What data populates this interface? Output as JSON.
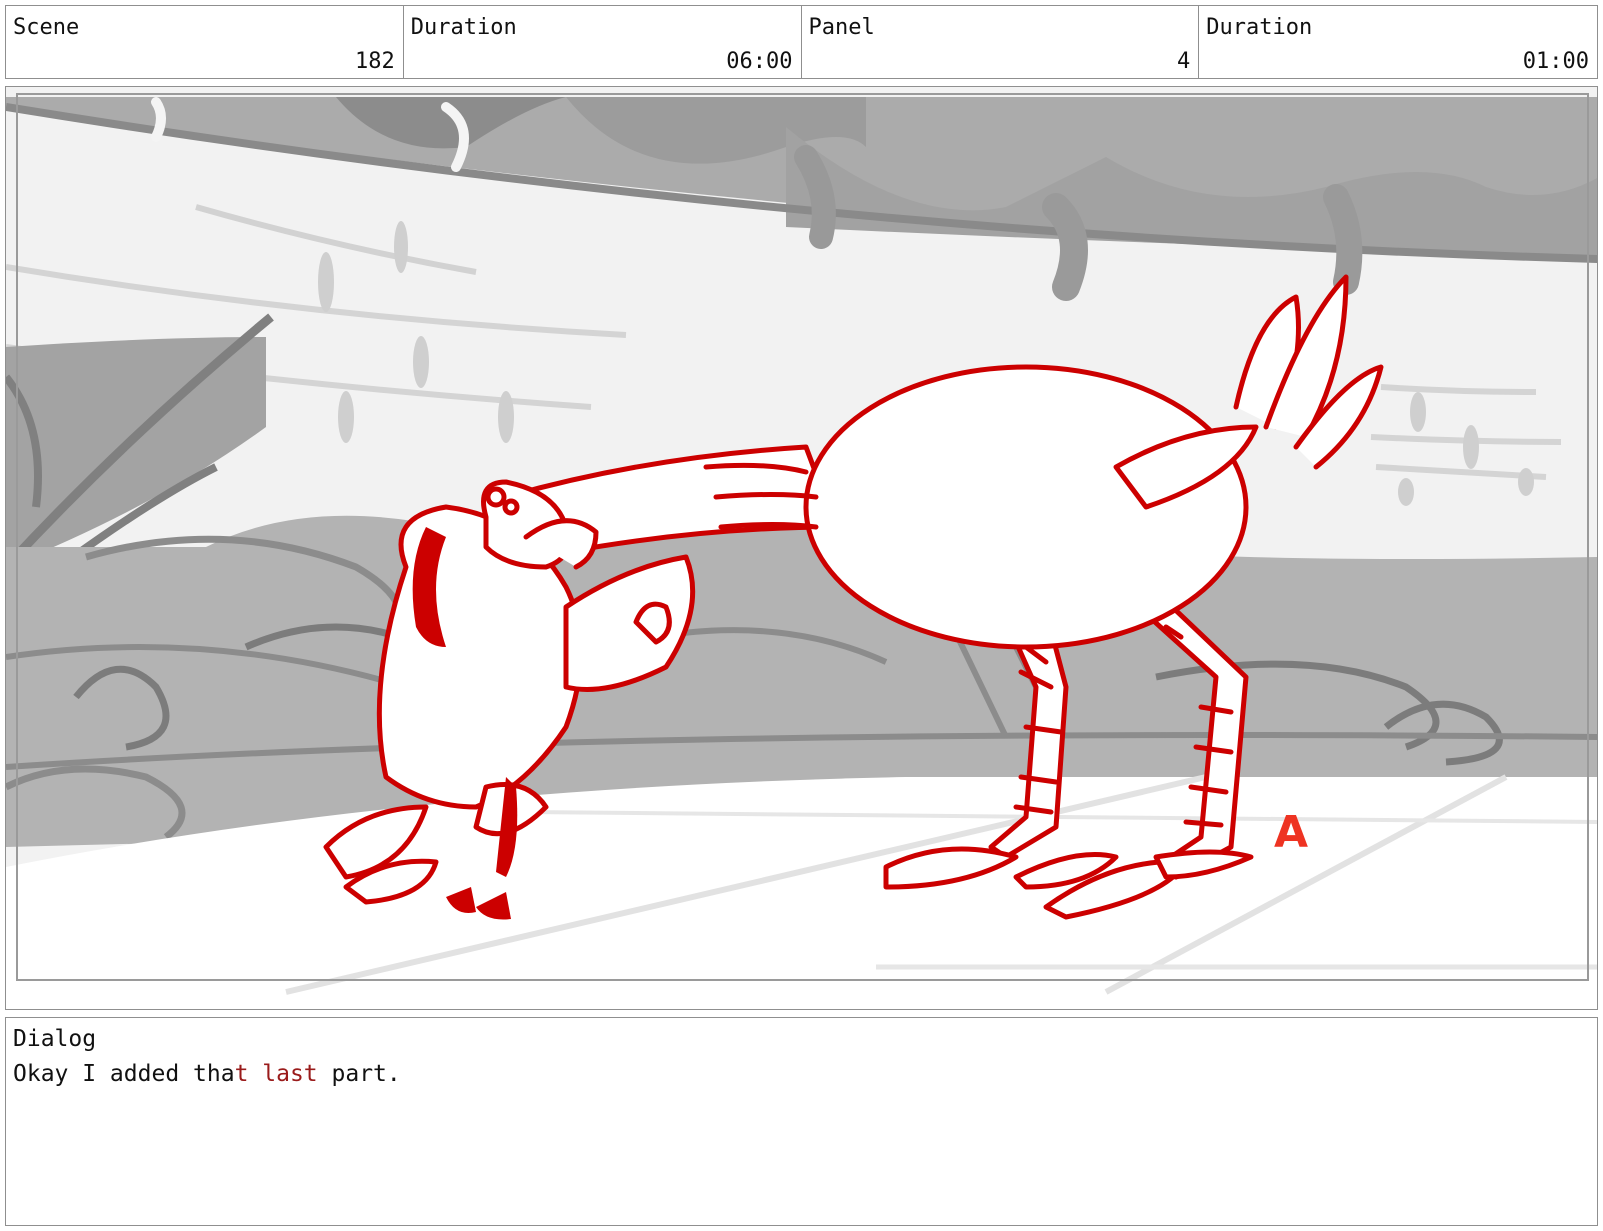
{
  "header": {
    "cells": [
      {
        "label": "Scene",
        "value": "182"
      },
      {
        "label": "Duration",
        "value": "06:00"
      },
      {
        "label": "Panel",
        "value": "4"
      },
      {
        "label": "Duration",
        "value": "01:00"
      }
    ]
  },
  "panel": {
    "image": "storyboard-sketch-two-birds-hugging",
    "annotation": "A",
    "colors": {
      "line": "#cc0000",
      "annotation": "#ee3322",
      "background_gray": "#9a9a9a"
    }
  },
  "dialog": {
    "label": "Dialog",
    "text_parts": [
      "Okay I added tha",
      "t last",
      " part."
    ]
  }
}
